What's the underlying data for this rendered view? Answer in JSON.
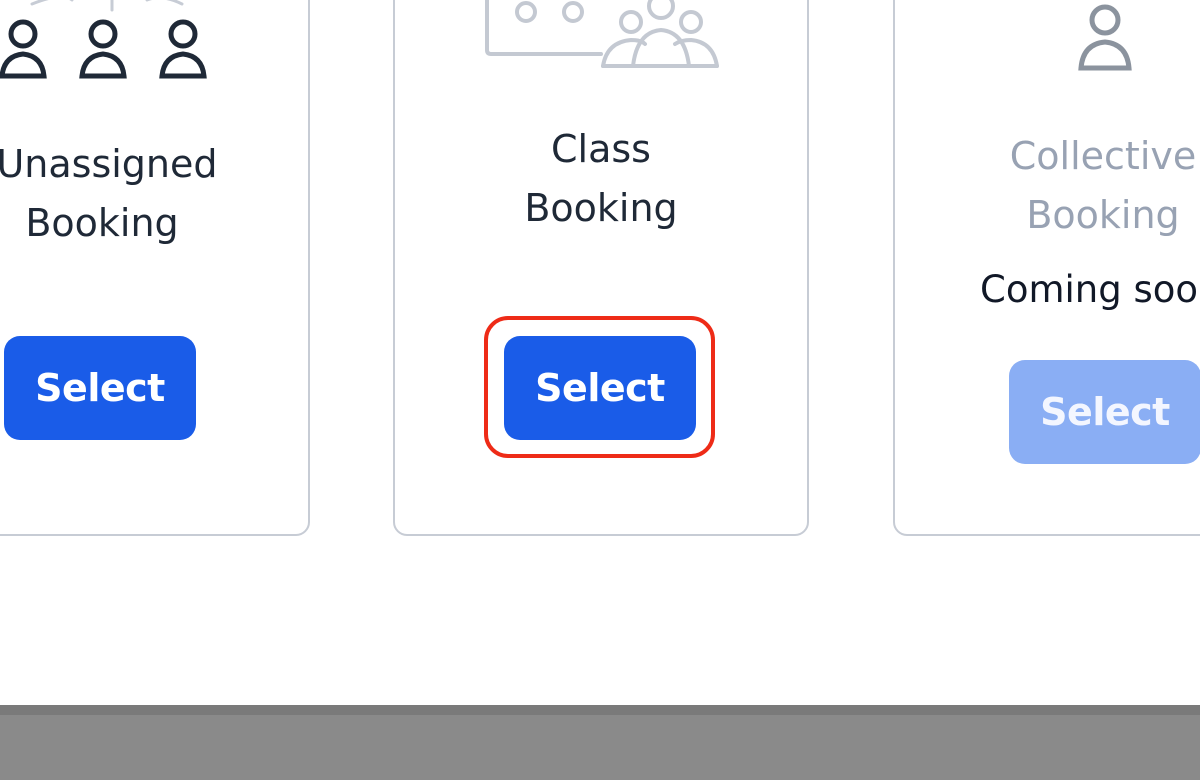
{
  "cards": [
    {
      "title_line1": "Unassigned",
      "title_line2": "Booking",
      "button_label": "Select",
      "icon": "people-group-icon",
      "state": "enabled"
    },
    {
      "title_line1": "Class",
      "title_line2": "Booking",
      "button_label": "Select",
      "icon": "class-room-icon",
      "state": "enabled",
      "highlighted": true
    },
    {
      "title_line1": "Collective",
      "title_line2": "Booking",
      "status_text": "Coming soon",
      "button_label": "Select",
      "icon": "person-icon",
      "state": "disabled"
    }
  ],
  "colors": {
    "primary_button": "#1a5ce8",
    "disabled_button": "#8aaef4",
    "highlight_ring": "#ee2b17",
    "card_border": "#c7ccd5",
    "footer_bar": "#8a8a8a"
  }
}
